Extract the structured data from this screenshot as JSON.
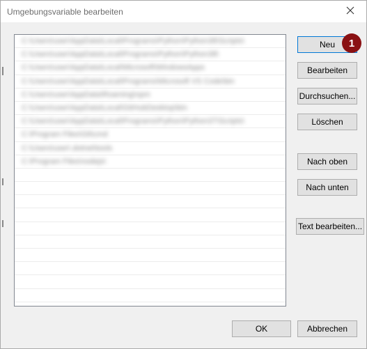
{
  "window": {
    "title": "Umgebungsvariable bearbeiten",
    "close_icon": "close-icon"
  },
  "path_list": {
    "entries": [
      "C:\\Users\\user\\AppData\\Local\\Programs\\Python\\Python38\\Scripts\\",
      "C:\\Users\\user\\AppData\\Local\\Programs\\Python\\Python38\\",
      "C:\\Users\\user\\AppData\\Local\\Microsoft\\WindowsApps",
      "C:\\Users\\user\\AppData\\Local\\Programs\\Microsoft VS Code\\bin",
      "C:\\Users\\user\\AppData\\Roaming\\npm",
      "C:\\Users\\user\\AppData\\Local\\GitHubDesktop\\bin",
      "C:\\Users\\user\\AppData\\Local\\Programs\\Python\\Python37\\Scripts\\",
      "C:\\Program Files\\Git\\cmd",
      "C:\\Users\\user\\.dotnet\\tools",
      "C:\\Program Files\\nodejs\\"
    ],
    "empty_rows": 11
  },
  "buttons": {
    "new": "Neu",
    "edit": "Bearbeiten",
    "browse": "Durchsuchen...",
    "delete": "Löschen",
    "move_up": "Nach oben",
    "move_down": "Nach unten",
    "edit_text": "Text bearbeiten...",
    "ok": "OK",
    "cancel": "Abbrechen"
  },
  "annotation": {
    "badge_number": "1",
    "badge_color": "#8a1113"
  },
  "colors": {
    "focus_border": "#0078d7",
    "button_face": "#e1e1e1",
    "dialog_background": "#f0f0f0"
  }
}
